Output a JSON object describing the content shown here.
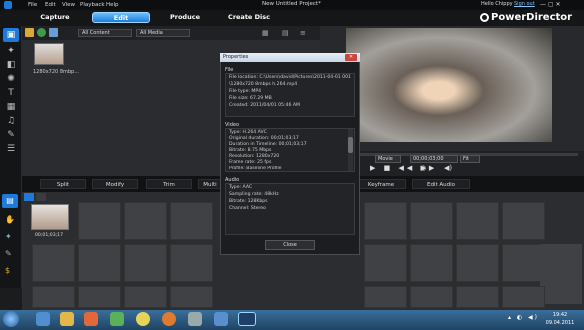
{
  "titlebar": {
    "menu": [
      "File",
      "Edit",
      "View",
      "Playback",
      "Help"
    ],
    "window_title": "New Untitled Project*",
    "user": "Hello Chippy",
    "signout": "Sign out"
  },
  "app": {
    "brand": "PowerDirector"
  },
  "tabs": [
    {
      "label": "Capture"
    },
    {
      "label": "Edit",
      "active": true
    },
    {
      "label": "Produce"
    },
    {
      "label": "Create Disc"
    }
  ],
  "library": {
    "filter1": "All Content",
    "filter2": "All Media",
    "thumb_label": "1280x720 8mbp..."
  },
  "preview": {
    "mode": "Movie",
    "timecode": "00;00;03;00",
    "fit": "Fit"
  },
  "function_bar": [
    "Split",
    "Modify",
    "Trim",
    "Multi",
    "",
    "Keyframe",
    "Edit Audio"
  ],
  "timeline": {
    "clip_label": "00;01;03;17"
  },
  "dialog": {
    "title": "Properties",
    "close_x": "✕",
    "file_section": "File",
    "file_lines": [
      "File location: C:\\Users\\david\\Pictures\\2011-04-01 001",
      "\\1280x720 8mbps h.264.mp4",
      "File type: MP4",
      "File size: 67.29 MB",
      "Created: 2011/04/01 05:46 AM"
    ],
    "video_section": "Video",
    "video_lines": [
      "Type: H.264 AVC",
      "Original duration: 00;01;03;17",
      "Duration in Timeline: 00;01;03;17",
      "Bitrate: 8.75 Mbps",
      "Resolution: 1280x720",
      "Frame rate: 25 fps",
      "Profile: Baseline Profile"
    ],
    "audio_section": "Audio",
    "audio_lines": [
      "Type: AAC",
      "Sampling rate: 48kHz",
      "Bitrate: 128Kbps",
      "Channel: Stereo"
    ],
    "close_button": "Close"
  },
  "tray": {
    "time": "19:42",
    "date": "09.04.2011"
  },
  "colors": {
    "accent": "#1e7ad8",
    "dialog_title": "#dce6f1",
    "taskbar": "#2b5a82"
  }
}
